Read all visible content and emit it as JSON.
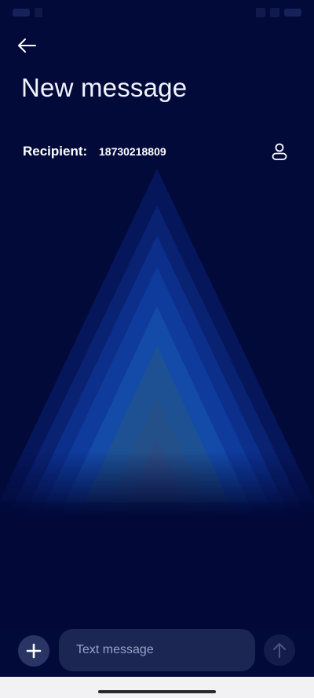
{
  "colors": {
    "background": "#020a3a",
    "text_primary": "#ffffff",
    "input_background": "#1c2653",
    "button_background": "#2a3566",
    "send_disabled": "#141d4a",
    "nav_bar": "#f2f2f4"
  },
  "header": {
    "back_icon": "arrow-left-icon",
    "title": "New message"
  },
  "recipient": {
    "label": "Recipient:",
    "value": "18730218809",
    "contact_icon": "person-icon"
  },
  "compose": {
    "attach_icon": "plus-icon",
    "placeholder": "Text message",
    "value": "",
    "send_icon": "arrow-up-icon",
    "send_enabled": false
  }
}
